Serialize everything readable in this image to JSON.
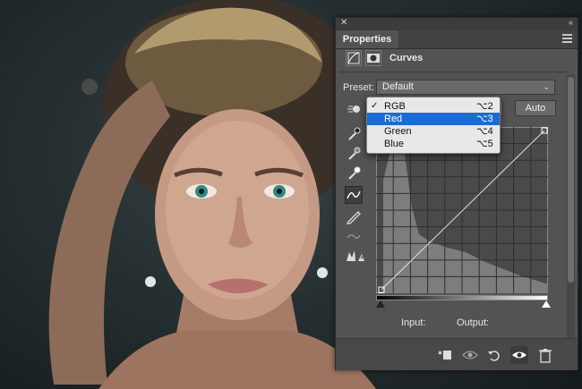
{
  "panel": {
    "tab_label": "Properties",
    "adjustment_title": "Curves",
    "preset_label": "Preset:",
    "preset_value": "Default",
    "auto_label": "Auto",
    "input_label": "Input:",
    "output_label": "Output:"
  },
  "channel_menu": {
    "items": [
      {
        "label": "RGB",
        "shortcut": "⌥2",
        "checked": true,
        "highlighted": false
      },
      {
        "label": "Red",
        "shortcut": "⌥3",
        "checked": false,
        "highlighted": true
      },
      {
        "label": "Green",
        "shortcut": "⌥4",
        "checked": false,
        "highlighted": false
      },
      {
        "label": "Blue",
        "shortcut": "⌥5",
        "checked": false,
        "highlighted": false
      }
    ],
    "check_glyph": "✓"
  },
  "tools": [
    "targeted-adjustment-icon",
    "black-point-eyedropper-icon",
    "gray-point-eyedropper-icon",
    "white-point-eyedropper-icon",
    "edit-points-curve-icon",
    "pencil-icon",
    "smooth-icon",
    "clipping-warning-icon"
  ],
  "footer_icons": [
    "clip-to-layer-icon",
    "view-previous-state-icon",
    "reset-icon",
    "visibility-eye-icon",
    "delete-trash-icon"
  ],
  "colors": {
    "panel_bg": "#535353",
    "highlight": "#1c6ad4",
    "menu_bg": "#e8e8e8"
  }
}
